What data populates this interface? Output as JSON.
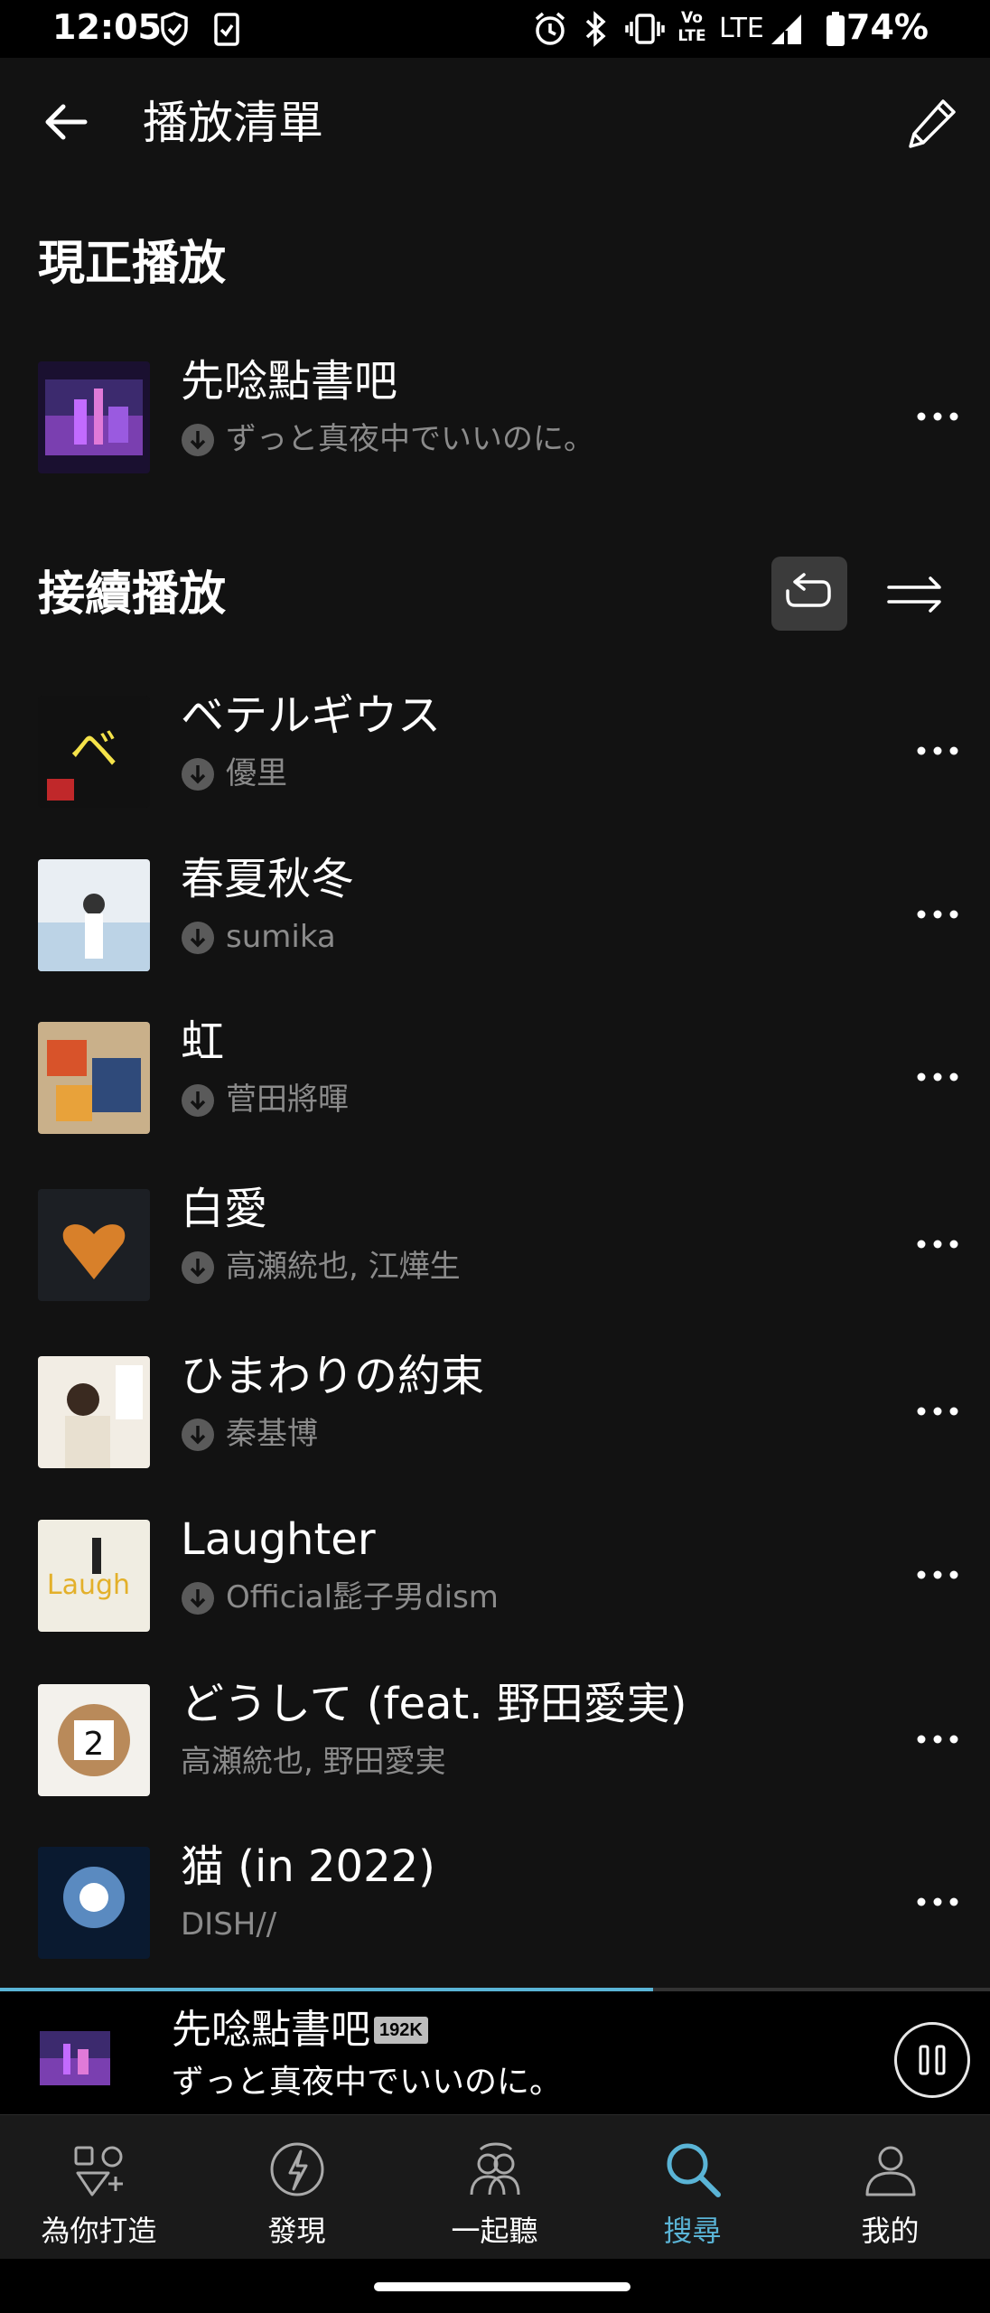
{
  "status": {
    "time": "12:05",
    "network": "LTE",
    "volte": "Vo LTE",
    "battery": "74%"
  },
  "header": {
    "title": "播放清單"
  },
  "now_playing": {
    "heading": "現正播放",
    "track": {
      "title": "先唸點書吧",
      "artist": "ずっと真夜中でいいのに。",
      "downloaded": true
    }
  },
  "up_next": {
    "heading": "接續播放",
    "repeat_active": true,
    "tracks": [
      {
        "title": "ベテルギウス",
        "artist": "優里",
        "downloaded": true
      },
      {
        "title": "春夏秋冬",
        "artist": "sumika",
        "downloaded": true
      },
      {
        "title": "虹",
        "artist": "菅田將暉",
        "downloaded": true
      },
      {
        "title": "白愛",
        "artist": "高瀬統也, 江燁生",
        "downloaded": true
      },
      {
        "title": "ひまわりの約束",
        "artist": "秦基博",
        "downloaded": true
      },
      {
        "title": "Laughter",
        "artist": "Official髭子男dism",
        "downloaded": true
      },
      {
        "title": "どうして (feat. 野田愛実)",
        "artist": "高瀬統也, 野田愛実",
        "downloaded": false
      },
      {
        "title": "猫 (in 2022)",
        "artist": "DISH//",
        "downloaded": false
      }
    ]
  },
  "mini_player": {
    "title": "先唸點書吧",
    "quality": "192K",
    "artist": "ずっと真夜中でいいのに。",
    "progress": 0.66
  },
  "nav": {
    "items": [
      {
        "label": "為你打造",
        "icon": "for-you-icon",
        "active": false
      },
      {
        "label": "發現",
        "icon": "compass-icon",
        "active": false
      },
      {
        "label": "一起聽",
        "icon": "listen-together-icon",
        "active": false
      },
      {
        "label": "搜尋",
        "icon": "search-icon",
        "active": true
      },
      {
        "label": "我的",
        "icon": "profile-icon",
        "active": false
      }
    ]
  },
  "colors": {
    "background": "#121212",
    "accent": "#5ab4d6",
    "secondary_text": "#8b8b8b"
  }
}
